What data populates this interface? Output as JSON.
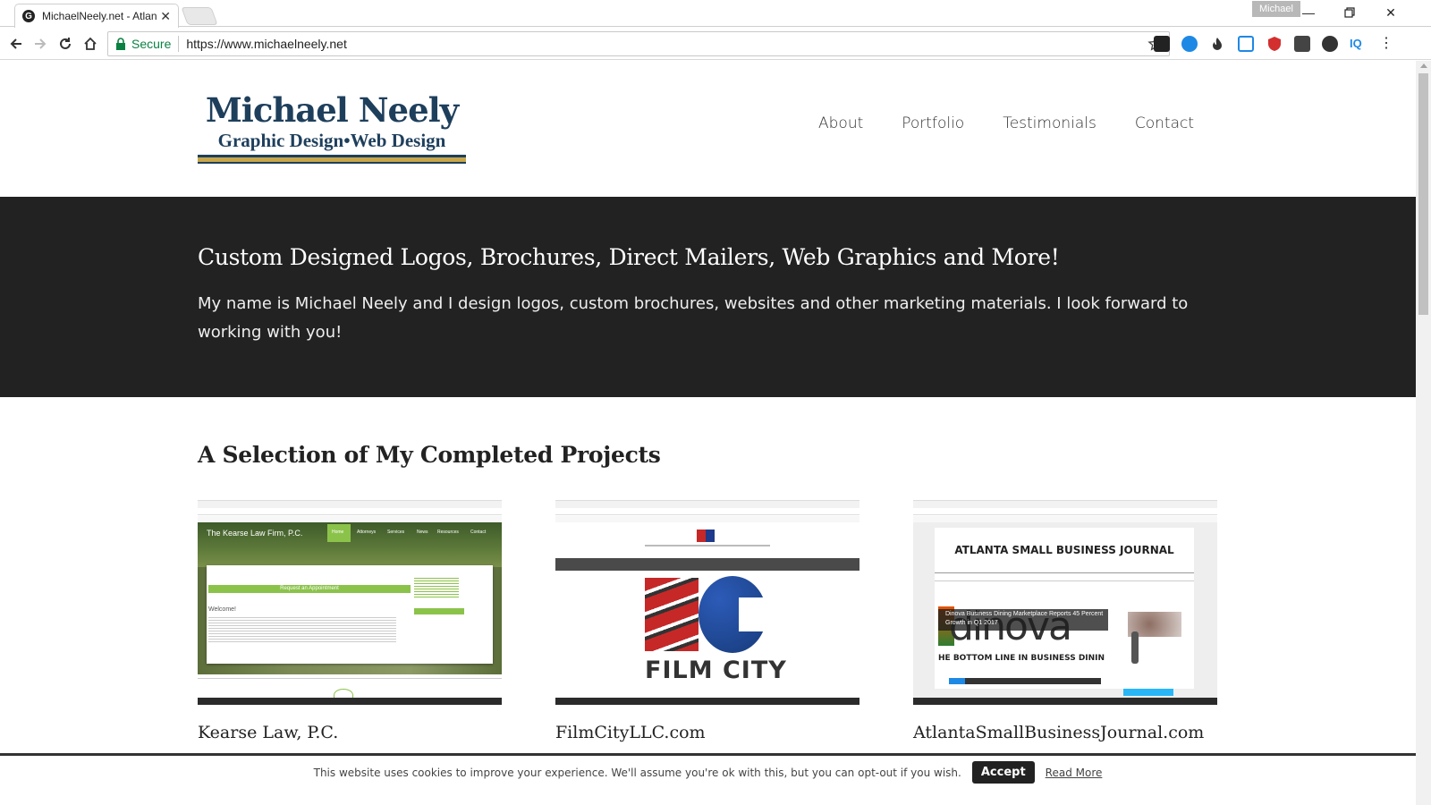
{
  "browser": {
    "tab_title": "MichaelNeely.net - Atlan",
    "tab_favicon": "G",
    "profile_name": "Michael",
    "secure_label": "Secure",
    "url": "https://www.michaelneely.net"
  },
  "site": {
    "logo_name": "Michael Neely",
    "logo_tagline": "Graphic Design•Web Design",
    "nav": [
      "About",
      "Portfolio",
      "Testimonials",
      "Contact"
    ],
    "hero_title": "Custom Designed Logos, Brochures, Direct Mailers, Web Graphics and More!",
    "hero_text": "My name is Michael Neely and I design logos, custom brochures, websites and other marketing materials. I look forward to working with you!",
    "projects_title": "A Selection of My Completed Projects",
    "projects": [
      {
        "caption": "Kearse Law, P.C.",
        "thumb_header": "The Kearse Law Firm, P.C.",
        "thumb_menu": [
          "Home",
          "Attorneys",
          "Services",
          "News",
          "Resources",
          "Contact"
        ],
        "thumb_cta": "Request an Appointment",
        "thumb_welcome": "Welcome!"
      },
      {
        "caption": "FilmCityLLC.com",
        "thumb_logo_text": "FILM CITY",
        "thumb_logo_letters": "FC"
      },
      {
        "caption": "AtlantaSmallBusinessJournal.com",
        "thumb_masthead": "ATLANTA SMALL BUSINESS JOURNAL",
        "thumb_headline": "Dinova Business Dining Marketplace Reports 45 Percent Growth in Q1 2017",
        "thumb_brand": "dinova",
        "thumb_banner": "HE BOTTOM LINE IN BUSINESS DININ"
      }
    ]
  },
  "cookie": {
    "message": "This website uses cookies to improve your experience. We'll assume you're ok with this, but you can opt-out if you wish.",
    "accept_label": "Accept",
    "read_more_label": "Read More"
  },
  "colors": {
    "hero_bg": "#222222",
    "logo_blue": "#1e3f5c",
    "logo_gold": "#c7a64a",
    "secure_green": "#0b8043"
  }
}
